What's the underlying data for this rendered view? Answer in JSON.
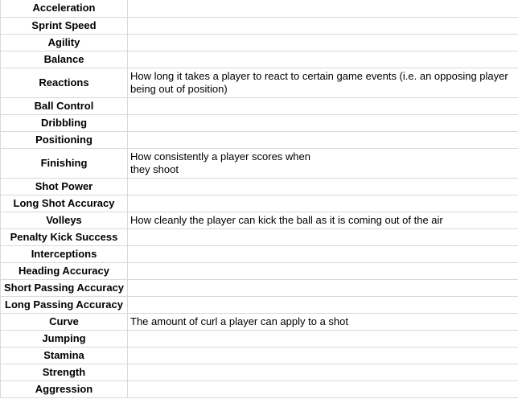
{
  "rows": [
    {
      "attribute": "Acceleration",
      "description": ""
    },
    {
      "attribute": "Sprint Speed",
      "description": ""
    },
    {
      "attribute": "Agility",
      "description": ""
    },
    {
      "attribute": "Balance",
      "description": ""
    },
    {
      "attribute": "Reactions",
      "description": "How long it takes a player to react to certain game events (i.e. an opposing player being out of position)"
    },
    {
      "attribute": "Ball Control",
      "description": ""
    },
    {
      "attribute": "Dribbling",
      "description": ""
    },
    {
      "attribute": "Positioning",
      "description": ""
    },
    {
      "attribute": "Finishing",
      "description": "How consistently a player scores when they shoot"
    },
    {
      "attribute": "Shot Power",
      "description": ""
    },
    {
      "attribute": "Long Shot Accuracy",
      "description": ""
    },
    {
      "attribute": "Volleys",
      "description": "How cleanly the player can kick the ball as it is coming out of the air"
    },
    {
      "attribute": "Penalty Kick Success",
      "description": ""
    },
    {
      "attribute": "Interceptions",
      "description": ""
    },
    {
      "attribute": "Heading Accuracy",
      "description": ""
    },
    {
      "attribute": "Short Passing Accuracy",
      "description": ""
    },
    {
      "attribute": "Long Passing Accuracy",
      "description": ""
    },
    {
      "attribute": "Curve",
      "description": "The amount of curl  a player can apply to a shot"
    },
    {
      "attribute": "Jumping",
      "description": ""
    },
    {
      "attribute": "Stamina",
      "description": ""
    },
    {
      "attribute": "Strength",
      "description": ""
    },
    {
      "attribute": "Aggression",
      "description": ""
    }
  ]
}
